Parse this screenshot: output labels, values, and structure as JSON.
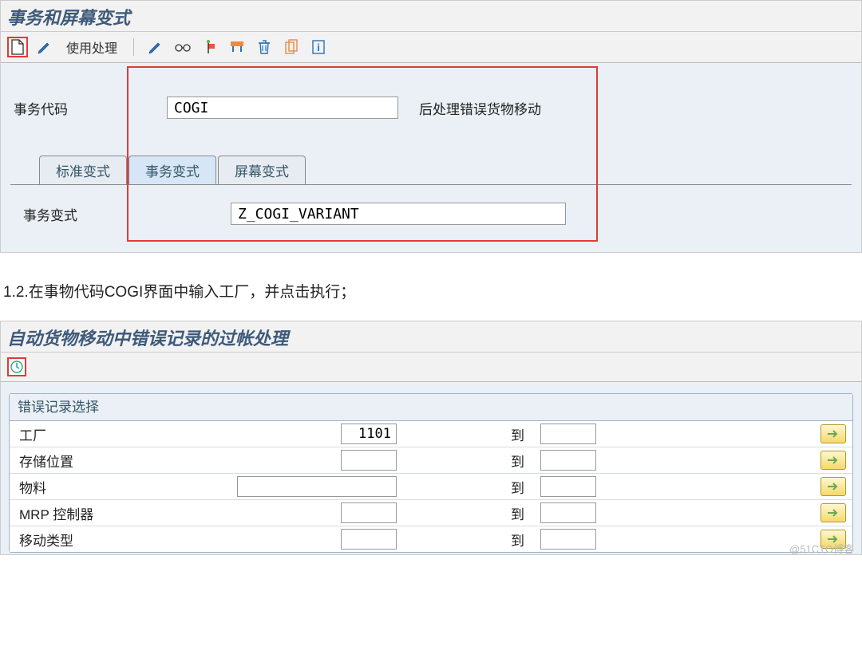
{
  "screen1": {
    "title": "事务和屏幕变式",
    "toolbar": {
      "use_processing": "使用处理"
    },
    "field_tcode_label": "事务代码",
    "field_tcode_value": "COGI",
    "field_tcode_desc": "后处理错误货物移动",
    "tabs": {
      "standard": "标准变式",
      "transaction": "事务变式",
      "screen": "屏幕变式"
    },
    "field_variant_label": "事务变式",
    "field_variant_value": "Z_COGI_VARIANT"
  },
  "caption": "1.2.在事物代码COGI界面中输入工厂，并点击执行；",
  "screen2": {
    "title": "自动货物移动中错误记录的过帐处理",
    "group_title": "错误记录选择",
    "to_label": "到",
    "rows": [
      {
        "label": "工厂",
        "from": "1101",
        "to": "",
        "wide": false
      },
      {
        "label": "存储位置",
        "from": "",
        "to": "",
        "wide": false
      },
      {
        "label": "物料",
        "from": "",
        "to": "",
        "wide": true
      },
      {
        "label": "MRP 控制器",
        "from": "",
        "to": "",
        "wide": false
      },
      {
        "label": "移动类型",
        "from": "",
        "to": "",
        "wide": false
      }
    ]
  },
  "watermark": "@51CTO博客"
}
